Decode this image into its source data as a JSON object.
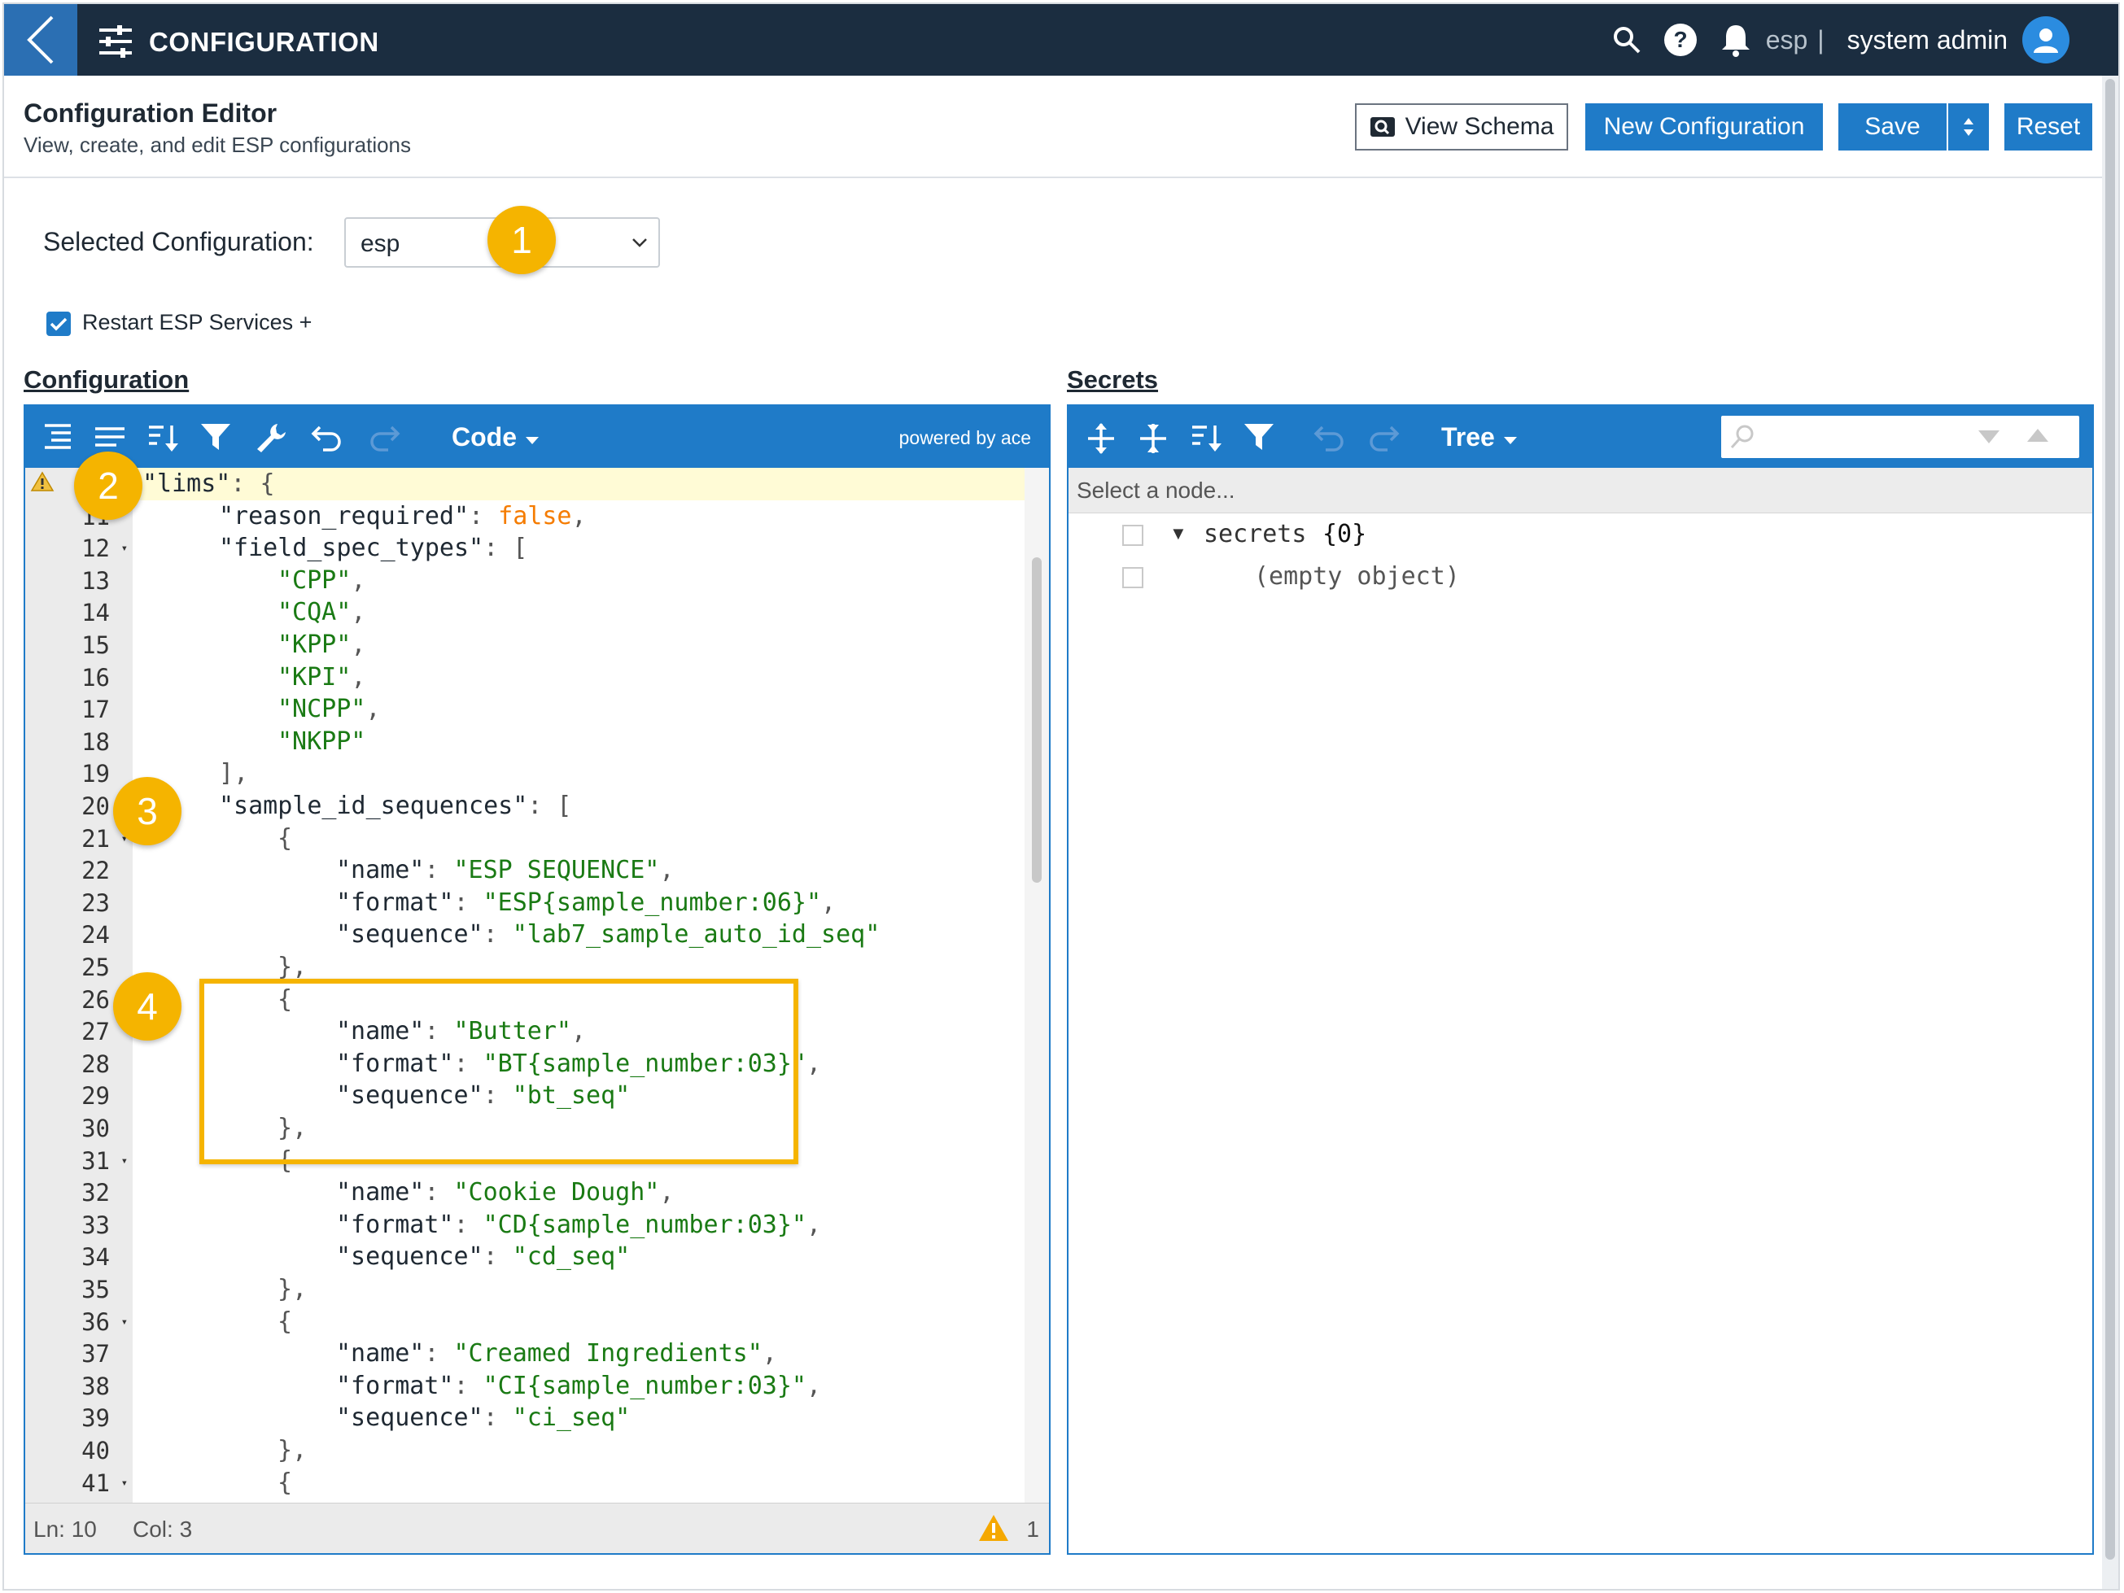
{
  "topbar": {
    "title": "CONFIGURATION",
    "tenant": "esp",
    "separator": "|",
    "user": "system admin"
  },
  "header": {
    "title": "Configuration Editor",
    "subtitle": "View, create, and edit ESP configurations",
    "view_schema_label": "View Schema",
    "new_config_label": "New Configuration",
    "save_label": "Save",
    "reset_label": "Reset"
  },
  "selection": {
    "label": "Selected Configuration:",
    "value": "esp"
  },
  "restart": {
    "label": "Restart ESP Services +",
    "checked": true
  },
  "configuration_panel": {
    "label": "Configuration",
    "mode": "Code",
    "powered_by": "powered by ace",
    "status_ln": "Ln: 10",
    "status_col": "Col: 3",
    "warning_count": "1"
  },
  "secrets_panel": {
    "label": "Secrets",
    "mode": "Tree",
    "node_prompt": "Select a node...",
    "root_key": "secrets",
    "root_count": "{0}",
    "empty_text": "(empty object)"
  },
  "code_lines": [
    {
      "n": "",
      "text": "\"lims\": {"
    },
    {
      "n": "11",
      "text": "\"reason_required\": false,"
    },
    {
      "n": "12",
      "text": "\"field_spec_types\": ["
    },
    {
      "n": "13",
      "text": "\"CPP\","
    },
    {
      "n": "14",
      "text": "\"CQA\","
    },
    {
      "n": "15",
      "text": "\"KPP\","
    },
    {
      "n": "16",
      "text": "\"KPI\","
    },
    {
      "n": "17",
      "text": "\"NCPP\","
    },
    {
      "n": "18",
      "text": "\"NKPP\""
    },
    {
      "n": "19",
      "text": "],"
    },
    {
      "n": "20",
      "text": "\"sample_id_sequences\": ["
    },
    {
      "n": "21",
      "text": "{"
    },
    {
      "n": "22",
      "text": "\"name\": \"ESP SEQUENCE\","
    },
    {
      "n": "23",
      "text": "\"format\": \"ESP{sample_number:06}\","
    },
    {
      "n": "24",
      "text": "\"sequence\": \"lab7_sample_auto_id_seq\""
    },
    {
      "n": "25",
      "text": "},"
    },
    {
      "n": "26",
      "text": "{"
    },
    {
      "n": "27",
      "text": "\"name\": \"Butter\","
    },
    {
      "n": "28",
      "text": "\"format\": \"BT{sample_number:03}\","
    },
    {
      "n": "29",
      "text": "\"sequence\": \"bt_seq\""
    },
    {
      "n": "30",
      "text": "},"
    },
    {
      "n": "31",
      "text": "{"
    },
    {
      "n": "32",
      "text": "\"name\": \"Cookie Dough\","
    },
    {
      "n": "33",
      "text": "\"format\": \"CD{sample_number:03}\","
    },
    {
      "n": "34",
      "text": "\"sequence\": \"cd_seq\""
    },
    {
      "n": "35",
      "text": "},"
    },
    {
      "n": "36",
      "text": "{"
    },
    {
      "n": "37",
      "text": "\"name\": \"Creamed Ingredients\","
    },
    {
      "n": "38",
      "text": "\"format\": \"CI{sample_number:03}\","
    },
    {
      "n": "39",
      "text": "\"sequence\": \"ci_seq\""
    },
    {
      "n": "40",
      "text": "},"
    },
    {
      "n": "41",
      "text": "{"
    }
  ],
  "callouts": [
    "1",
    "2",
    "3",
    "4"
  ],
  "colors": {
    "topbar": "#1b2d40",
    "accent": "#1f7bc8",
    "callout": "#f5b400",
    "string": "#1a7a14",
    "boolean": "#f57c00"
  }
}
